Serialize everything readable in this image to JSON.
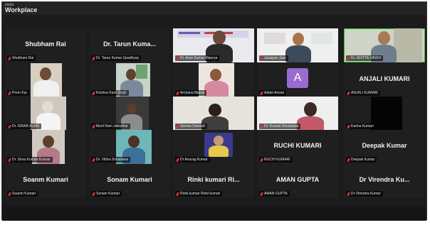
{
  "app": {
    "brand_top": "zoom",
    "brand_main": "Workplace"
  },
  "tiles": [
    {
      "display_name": "Shubham Rai",
      "label": "Shubham Rai"
    },
    {
      "display_name": "Dr. Tarun Kuma...",
      "label": "Dr. Tarun Kumar Upadhyay"
    },
    {
      "display_name": "",
      "label": "Dr. Arun Kumar Maurya"
    },
    {
      "display_name": "",
      "label": "Jasaiyan Jam"
    },
    {
      "display_name": "",
      "label": "Dr. ADITYA SINGH"
    },
    {
      "display_name": "",
      "label": "Prem Kar"
    },
    {
      "display_name": "",
      "label": "Krishna Kant Singh"
    },
    {
      "display_name": "",
      "label": "Archana Malvia"
    },
    {
      "display_name": "",
      "label": "Adam Ansari",
      "avatar_letter": "A"
    },
    {
      "display_name": "ANJALI KUMARI",
      "label": "ANJALI KUMARI"
    },
    {
      "display_name": "",
      "label": "Dr. ISRAR ALAM"
    },
    {
      "display_name": "",
      "label": "Murli Ram Jabodhar"
    },
    {
      "display_name": "",
      "label": "Seema Dwivedi"
    },
    {
      "display_name": "",
      "label": "Dr. Kumari Srivastava"
    },
    {
      "display_name": "",
      "label": "Karina Kumari"
    },
    {
      "display_name": "",
      "label": "Dr. Sima Kumari Kumari"
    },
    {
      "display_name": "",
      "label": "Dr. Vibha Srivastava"
    },
    {
      "display_name": "",
      "label": "Dr Anurag Kumar"
    },
    {
      "display_name": "RUCHI KUMARI",
      "label": "RUCHI KUMARI"
    },
    {
      "display_name": "Deepak Kumar",
      "label": "Deepak Kumar"
    },
    {
      "display_name": "Soanm Kumari",
      "label": "Soanm Kumari"
    },
    {
      "display_name": "Sonam Kumari",
      "label": "Sonam Kumari"
    },
    {
      "display_name": "Rinki kumari Ri...",
      "label": "Rinki kumari Rinki kumari"
    },
    {
      "display_name": "AMAN GUPTA",
      "label": "AMAN GUPTA"
    },
    {
      "display_name": "Dr Virendra Ku...",
      "label": "Dr Virendra Kumar"
    }
  ],
  "colors": {
    "active_speaker": "#2ec02e",
    "muted_mic": "#e03030",
    "avatar_bg": "#9a6bd0"
  }
}
